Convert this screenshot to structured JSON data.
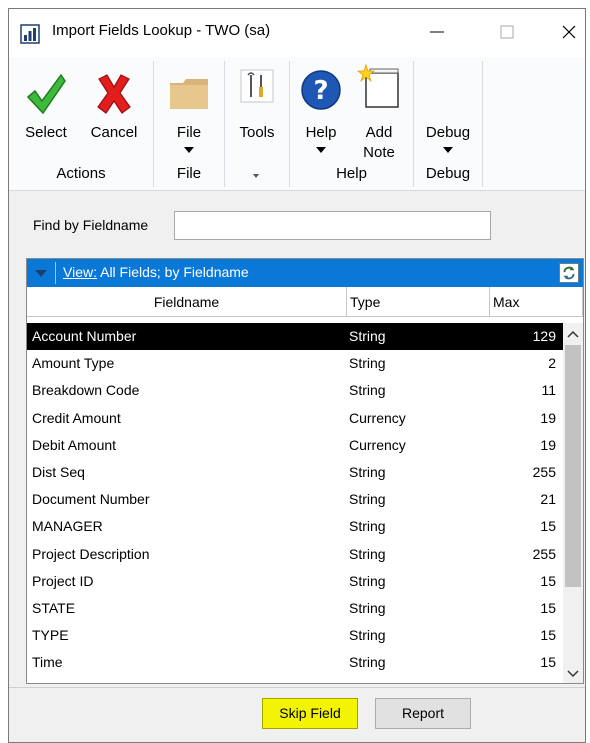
{
  "window": {
    "title": "Import Fields Lookup  -  TWO (sa)"
  },
  "ribbon": {
    "groups": [
      {
        "label": "Actions",
        "buttons": [
          "Select",
          "Cancel"
        ]
      },
      {
        "label": "File",
        "buttons": [
          "File"
        ]
      },
      {
        "label": "",
        "buttons": [
          "Tools"
        ]
      },
      {
        "label": "Help",
        "buttons": [
          "Help",
          "Add Note"
        ]
      },
      {
        "label": "Debug",
        "buttons": [
          "Debug"
        ]
      }
    ],
    "select_label": "Select",
    "cancel_label": "Cancel",
    "file_label": "File",
    "tools_label": "Tools",
    "help_label": "Help",
    "add_note_line1": "Add",
    "add_note_line2": "Note",
    "debug_label": "Debug",
    "group_actions": "Actions",
    "group_file": "File",
    "group_help": "Help",
    "group_debug": "Debug"
  },
  "find": {
    "label": "Find by Fieldname",
    "value": ""
  },
  "grid": {
    "view_prefix": "View:",
    "view_text": " All Fields; by Fieldname",
    "columns": [
      "Fieldname",
      "Type",
      "Max"
    ],
    "rows": [
      {
        "fieldname": "Account Number",
        "type": "String",
        "max": "129",
        "selected": true
      },
      {
        "fieldname": "Amount Type",
        "type": "String",
        "max": "2"
      },
      {
        "fieldname": "Breakdown Code",
        "type": "String",
        "max": "11"
      },
      {
        "fieldname": "Credit Amount",
        "type": "Currency",
        "max": "19"
      },
      {
        "fieldname": "Debit Amount",
        "type": "Currency",
        "max": "19"
      },
      {
        "fieldname": "Dist Seq",
        "type": "String",
        "max": "255"
      },
      {
        "fieldname": "Document Number",
        "type": "String",
        "max": "21"
      },
      {
        "fieldname": "MANAGER",
        "type": "String",
        "max": "15"
      },
      {
        "fieldname": "Project Description",
        "type": "String",
        "max": "255"
      },
      {
        "fieldname": "Project ID",
        "type": "String",
        "max": "15"
      },
      {
        "fieldname": "STATE",
        "type": "String",
        "max": "15"
      },
      {
        "fieldname": "TYPE",
        "type": "String",
        "max": "15"
      },
      {
        "fieldname": "Time",
        "type": "String",
        "max": "15"
      }
    ]
  },
  "buttons": {
    "skip_field": "Skip Field",
    "report": "Report"
  },
  "colors": {
    "view_bar": "#0a78d7",
    "selected_row": "#000000",
    "skip_highlight": "#f3f500"
  }
}
